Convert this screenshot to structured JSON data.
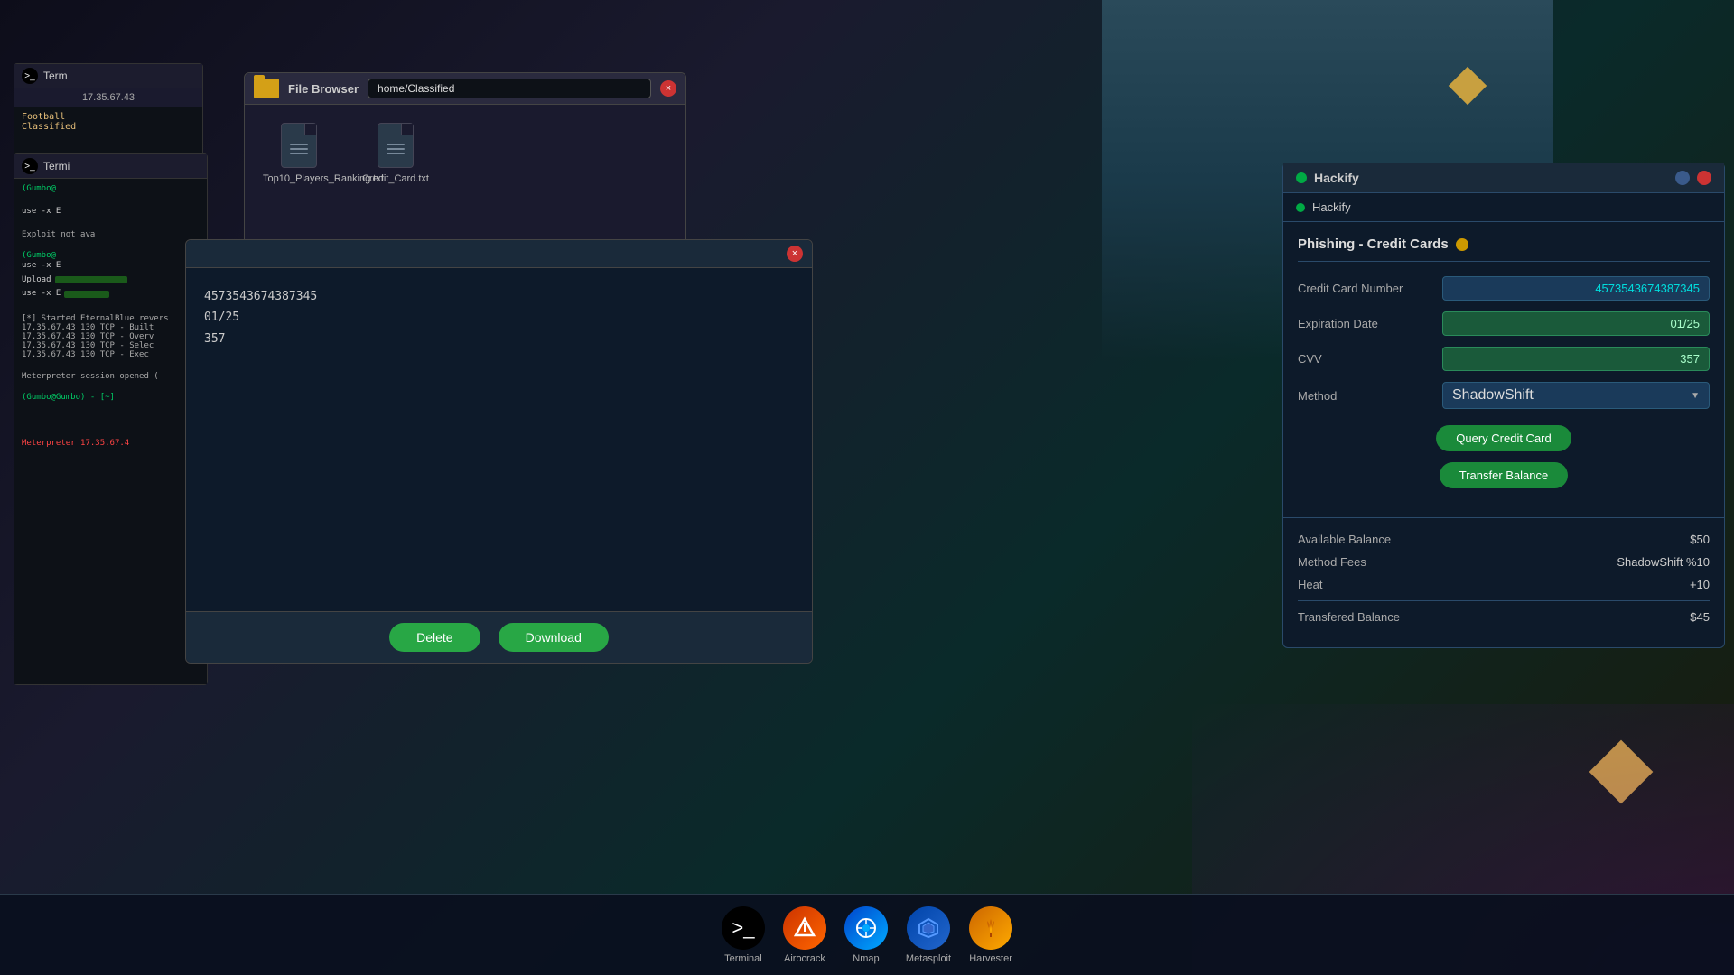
{
  "wallpaper": {
    "alt": "Cyber background"
  },
  "terminal_small": {
    "title": "Term",
    "ip": "17.35.67.43",
    "folder1": "Football",
    "folder2": "Classified"
  },
  "terminal_main": {
    "title": "Termi",
    "lines": [
      "(Gumbo@",
      "",
      "use -x E",
      "",
      "Exploit not ava",
      "",
      "(Gumbo@",
      "use -x E",
      "Upload",
      "",
      "[*] Started EternalBlue revers",
      "17.35.67.43 130 TCP - Built",
      "17.35.67.43 130 TCP - Overv",
      "17.35.67.43 130 TCP - Selec",
      "17.35.67.43 130 TCP - Exec",
      "",
      "Meterpreter session opened (",
      "",
      "(Gumbo@Gumbo) - [~]",
      "",
      "Meterpreter 17.35.67.4"
    ],
    "cursor": "—"
  },
  "file_browser": {
    "title": "File Browser",
    "path": "home/Classified",
    "files": [
      {
        "name": "Top10_Players_Ranking.txt"
      },
      {
        "name": "Credit_Card.txt"
      }
    ],
    "close_label": "×"
  },
  "text_viewer": {
    "content_line1": "4573543674387345",
    "content_line2": "01/25",
    "content_line3": "357",
    "close_label": "×",
    "delete_label": "Delete",
    "download_label": "Download"
  },
  "hackify": {
    "window_title": "Hackify",
    "nav_label": "Hackify",
    "min_label": "−",
    "close_label": "×",
    "section_title": "Phishing - Credit Cards",
    "fields": {
      "credit_card_label": "Credit Card Number",
      "credit_card_value": "4573543674387345",
      "expiration_label": "Expiration Date",
      "expiration_value": "01/25",
      "cvv_label": "CVV",
      "cvv_value": "357",
      "method_label": "Method",
      "method_value": "ShadowShift"
    },
    "buttons": {
      "query_label": "Query Credit Card",
      "transfer_label": "Transfer Balance"
    },
    "info": {
      "available_balance_label": "Available Balance",
      "available_balance_value": "$50",
      "method_fees_label": "Method Fees",
      "method_fees_value": "ShadowShift %10",
      "heat_label": "Heat",
      "heat_value": "+10",
      "transferred_balance_label": "Transfered Balance",
      "transferred_balance_value": "$45"
    }
  },
  "taskbar": {
    "items": [
      {
        "label": "Terminal",
        "icon": "terminal"
      },
      {
        "label": "Airocrack",
        "icon": "airocrack"
      },
      {
        "label": "Nmap",
        "icon": "nmap"
      },
      {
        "label": "Metasploit",
        "icon": "metasploit"
      },
      {
        "label": "Harvester",
        "icon": "harvester"
      }
    ]
  }
}
